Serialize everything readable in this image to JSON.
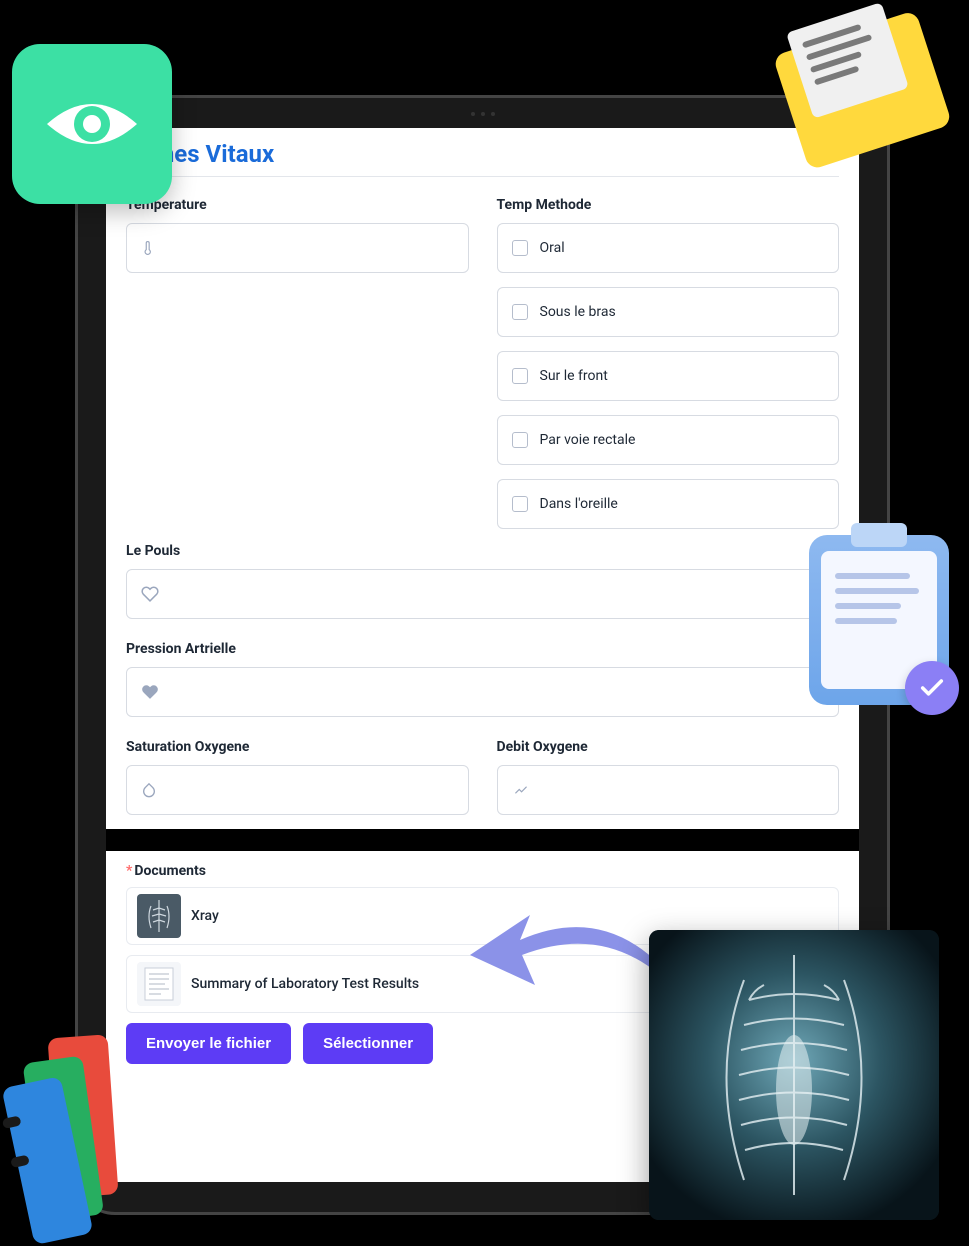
{
  "section": {
    "title": "Signes Vitaux"
  },
  "fields": {
    "temperature_label": "Temperature",
    "temp_method_label": "Temp Methode",
    "pulse_label": "Le Pouls",
    "blood_pressure_label": "Pression Artrielle",
    "oxygen_sat_label": "Saturation Oxygene",
    "oxygen_flow_label": "Debit Oxygene"
  },
  "temp_methods": [
    "Oral",
    "Sous le bras",
    "Sur le front",
    "Par voie rectale",
    "Dans l'oreille"
  ],
  "documents": {
    "label": "Documents",
    "items": [
      {
        "name": "Xray"
      },
      {
        "name": "Summary of Laboratory Test Results"
      }
    ]
  },
  "buttons": {
    "send_file": "Envoyer le fichier",
    "select": "Sélectionner"
  }
}
